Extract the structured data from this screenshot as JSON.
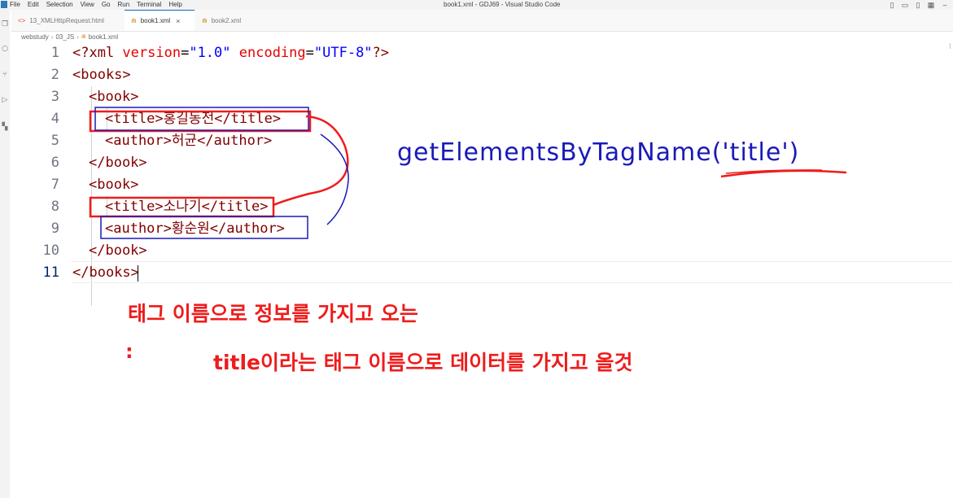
{
  "window": {
    "title": "book1.xml - GDJ69 - Visual Studio Code",
    "menu": [
      "File",
      "Edit",
      "Selection",
      "View",
      "Go",
      "Run",
      "Terminal",
      "Help"
    ]
  },
  "tabs": [
    {
      "label": "13_XMLHttpRequest.html",
      "icon": "html-file-icon",
      "active": false
    },
    {
      "label": "book1.xml",
      "icon": "xml-file-icon",
      "active": true,
      "close": "×"
    },
    {
      "label": "book2.xml",
      "icon": "xml-file-icon",
      "active": false
    }
  ],
  "breadcrumb": [
    "webstudy",
    "03_JS",
    "book1.xml"
  ],
  "editor": {
    "lines": [
      {
        "n": "1",
        "text": "<?xml version=\"1.0\" encoding=\"UTF-8\"?>"
      },
      {
        "n": "2",
        "text": "<books>"
      },
      {
        "n": "3",
        "text": "<book>"
      },
      {
        "n": "4",
        "text": "<title>홍길동전</title>"
      },
      {
        "n": "5",
        "text": "<author>허균</author>"
      },
      {
        "n": "6",
        "text": "</book>"
      },
      {
        "n": "7",
        "text": "<book>"
      },
      {
        "n": "8",
        "text": "<title>소나기</title>"
      },
      {
        "n": "9",
        "text": "<author>황순원</author>"
      },
      {
        "n": "10",
        "text": "</book>"
      },
      {
        "n": "11",
        "text": "</books>"
      }
    ],
    "current_line": "11"
  },
  "annotations": {
    "method": "getElementsByTagName('title')",
    "note1": "태그 이름으로 정보를 가지고 오는",
    "colon": ":",
    "note2": "title이라는 태그 이름으로 데이터를 가지고 올것",
    "colors": {
      "red": "#ee1c1c",
      "blue": "#1a1ab8"
    }
  }
}
